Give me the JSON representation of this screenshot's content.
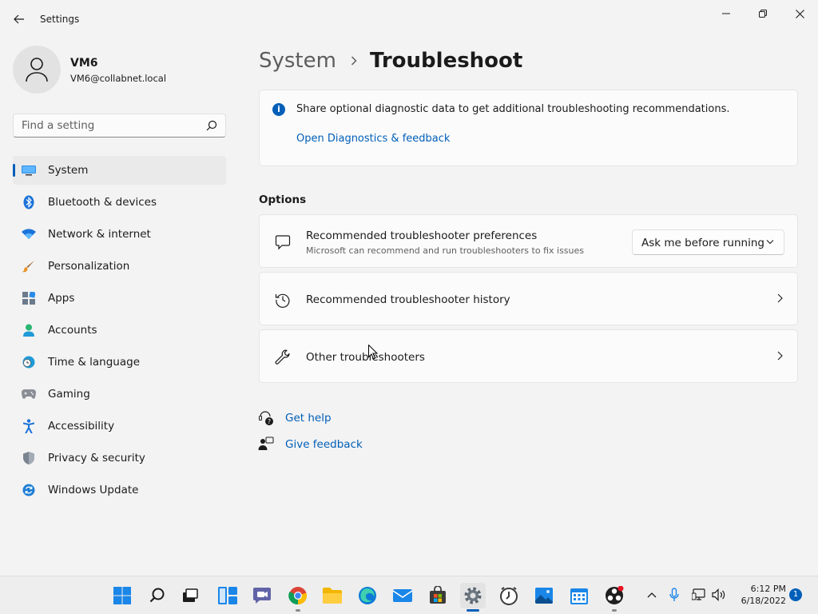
{
  "window": {
    "title": "Settings",
    "controls": [
      "minimize-icon",
      "maximize-icon",
      "close-icon"
    ]
  },
  "profile": {
    "name": "VM6",
    "email": "VM6@collabnet.local"
  },
  "search": {
    "placeholder": "Find a setting",
    "value": ""
  },
  "sidebar": {
    "items": [
      {
        "label": "System",
        "icon": "monitor-icon",
        "active": true
      },
      {
        "label": "Bluetooth & devices",
        "icon": "bluetooth-icon"
      },
      {
        "label": "Network & internet",
        "icon": "wifi-icon"
      },
      {
        "label": "Personalization",
        "icon": "brush-icon"
      },
      {
        "label": "Apps",
        "icon": "apps-icon"
      },
      {
        "label": "Accounts",
        "icon": "accounts-icon"
      },
      {
        "label": "Time & language",
        "icon": "globe-clock-icon"
      },
      {
        "label": "Gaming",
        "icon": "gamepad-icon"
      },
      {
        "label": "Accessibility",
        "icon": "accessibility-icon"
      },
      {
        "label": "Privacy & security",
        "icon": "shield-icon"
      },
      {
        "label": "Windows Update",
        "icon": "update-icon"
      }
    ]
  },
  "breadcrumb": {
    "parent": "System",
    "current": "Troubleshoot"
  },
  "info": {
    "text": "Share optional diagnostic data to get additional troubleshooting recommendations.",
    "link": "Open Diagnostics & feedback"
  },
  "options": {
    "title": "Options",
    "preferences": {
      "title": "Recommended troubleshooter preferences",
      "subtitle": "Microsoft can recommend and run troubleshooters to fix issues",
      "selected": "Ask me before running"
    },
    "history": {
      "title": "Recommended troubleshooter history"
    },
    "other": {
      "title": "Other troubleshooters"
    }
  },
  "help_links": {
    "get_help": "Get help",
    "give_feedback": "Give feedback"
  },
  "taskbar": {
    "apps": [
      "start-icon",
      "search-icon",
      "task-view-icon",
      "widgets-icon",
      "teams-chat-icon",
      "chrome-icon",
      "file-explorer-icon",
      "edge-icon",
      "mail-icon",
      "store-icon",
      "settings-icon",
      "clock-app-icon",
      "photos-icon",
      "calendar-icon",
      "obs-icon"
    ],
    "time": "6:12 PM",
    "date": "6/18/2022",
    "notifications": "1"
  },
  "colors": {
    "accent": "#005fb8",
    "background": "#f3f3f3",
    "card": "#fbfbfb"
  }
}
